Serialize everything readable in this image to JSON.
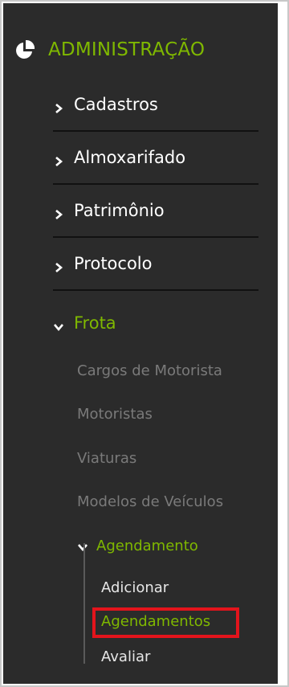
{
  "section": {
    "title": "ADMINISTRAÇÃO",
    "icon": "pie-chart-icon",
    "accent": "#7fb800"
  },
  "menu": [
    {
      "label": "Cadastros",
      "icon": "chevron-right-icon",
      "expanded": false
    },
    {
      "label": "Almoxarifado",
      "icon": "chevron-right-icon",
      "expanded": false
    },
    {
      "label": "Patrimônio",
      "icon": "chevron-right-icon",
      "expanded": false
    },
    {
      "label": "Protocolo",
      "icon": "chevron-right-icon",
      "expanded": false
    },
    {
      "label": "Frota",
      "icon": "chevron-down-icon",
      "expanded": true
    }
  ],
  "frota": {
    "items": [
      {
        "label": "Cargos de Motorista"
      },
      {
        "label": "Motoristas"
      },
      {
        "label": "Viaturas"
      },
      {
        "label": "Modelos de Veículos"
      }
    ],
    "agendamento": {
      "label": "Agendamento",
      "icon": "chevron-down-icon",
      "items": [
        {
          "label": "Adicionar"
        },
        {
          "label": "Agendamentos",
          "current": true
        },
        {
          "label": "Avaliar"
        }
      ]
    }
  },
  "colors": {
    "panel_bg": "#2b2b2b",
    "accent_green": "#7fb800",
    "muted_text": "#7a7a7a",
    "highlight_red": "#e3141c"
  }
}
